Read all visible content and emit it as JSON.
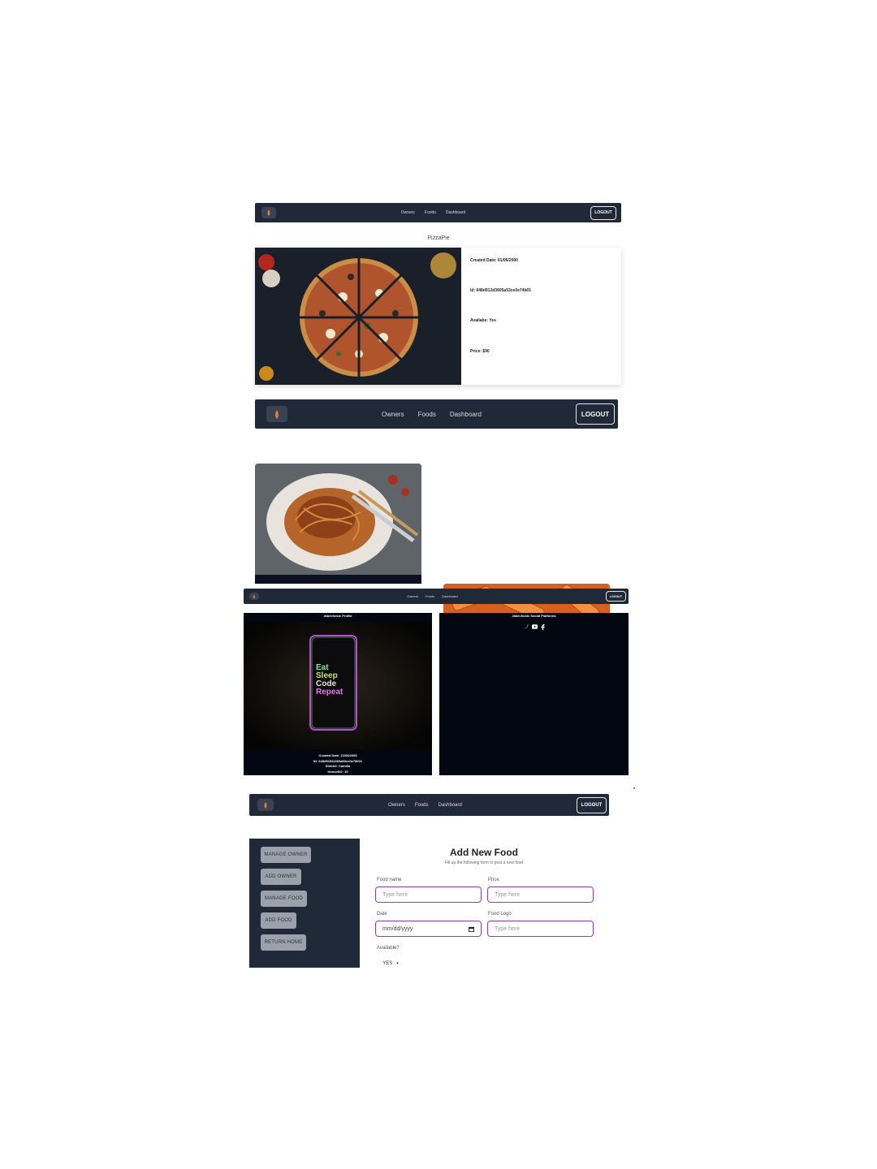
{
  "nav": {
    "links": [
      "Owners",
      "Foods",
      "Dashboard"
    ],
    "logout_label": "LOGOUT"
  },
  "food_detail": {
    "title": "PizzaPie",
    "created": "Created Date: 01/06/2000",
    "id": "Id: 648d912d3605a53ce0e74b01",
    "available": "Availabe: Yes",
    "price": "Price: $90"
  },
  "profile": {
    "left_title": "Jabechosic Profile",
    "phone_text": [
      "Eat",
      "Sleep",
      "Code",
      "Repeat"
    ],
    "created": "Created Date: 21/06/2005",
    "id": "ID: 648d91541605a53ce0e78021",
    "district": "District: Camilla",
    "house": "HouseNO: 10",
    "right_title": "Jabechosic Social Platforms",
    "social_icons": [
      "twitter-icon",
      "youtube-icon",
      "facebook-icon"
    ]
  },
  "sidebar": {
    "items": [
      "MANAGE OWNER",
      "ADD OWNER",
      "MANAGE FOOD",
      "ADD FOOD",
      "RETURN HOME"
    ]
  },
  "form": {
    "title": "Add New Food",
    "subtitle": "Fill up the following form to post a new food",
    "food_name_label": "Food name",
    "food_name_placeholder": "Type here",
    "price_label": "Price",
    "price_placeholder": "Type here",
    "date_label": "Date",
    "date_placeholder": "mm/dd/yyyy",
    "logo_label": "Food Logo",
    "logo_placeholder": "Type here",
    "available_label": "Available?",
    "available_value": "YES"
  },
  "colors": {
    "nav_bg": "#1f2937",
    "dark_bg": "#030712",
    "sidebar_bg": "#1f2937",
    "input_border": "#8e3fb5",
    "accent_red": "#e11d48"
  }
}
